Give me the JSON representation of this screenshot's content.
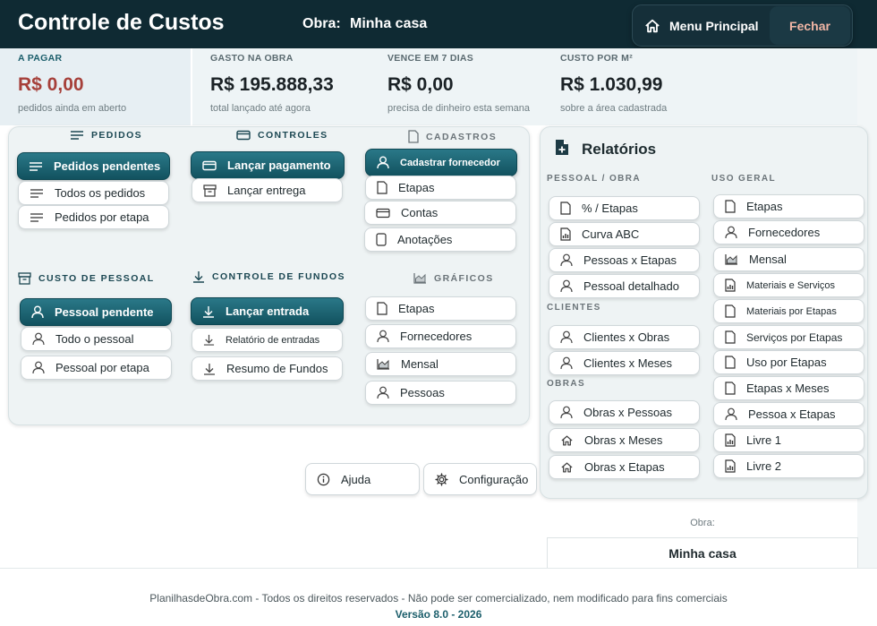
{
  "header": {
    "title": "Controle de Custos",
    "obra_label": "Obra:",
    "obra_name": "Minha casa",
    "menu_label": "Menu Principal",
    "fechar_label": "Fechar"
  },
  "kpis": [
    {
      "label": "A PAGAR",
      "value": "R$ 0,00",
      "sub": "pedidos ainda em aberto"
    },
    {
      "label": "GASTO NA OBRA",
      "value": "R$ 195.888,33",
      "sub": "total lançado até agora"
    },
    {
      "label": "VENCE EM 7 DIAS",
      "value": "R$ 0,00",
      "sub": "precisa de dinheiro esta semana"
    },
    {
      "label": "CUSTO POR M²",
      "value": "R$ 1.030,99",
      "sub": "sobre a área cadastrada"
    }
  ],
  "sections": {
    "pedidos": {
      "title": "PEDIDOS",
      "items": [
        "Pedidos pendentes",
        "Todos os pedidos",
        "Pedidos por etapa"
      ]
    },
    "controles": {
      "title": "CONTROLES",
      "items": [
        "Lançar pagamento",
        "Lançar entrega"
      ]
    },
    "cadastros": {
      "title": "CADASTROS",
      "items": [
        "Cadastrar fornecedor",
        "Etapas",
        "Contas",
        "Anotações"
      ]
    },
    "custo_pessoal": {
      "title": "CUSTO DE PESSOAL",
      "items": [
        "Pessoal pendente",
        "Todo o pessoal",
        "Pessoal por etapa"
      ]
    },
    "controle_fundos": {
      "title": "CONTROLE DE FUNDOS",
      "items": [
        "Lançar entrada",
        "Relatório de entradas",
        "Resumo de Fundos"
      ]
    },
    "graficos": {
      "title": "GRÁFICOS",
      "items": [
        "Etapas",
        "Fornecedores",
        "Mensal",
        "Pessoas"
      ]
    }
  },
  "relatorios": {
    "title": "Relatórios",
    "pessoal_obra": {
      "title": "PESSOAL / OBRA",
      "items": [
        "% / Etapas",
        "Curva ABC",
        "Pessoas x Etapas",
        "Pessoal detalhado"
      ]
    },
    "clientes": {
      "title": "CLIENTES",
      "items": [
        "Clientes x Obras",
        "Clientes x Meses"
      ]
    },
    "obras": {
      "title": "OBRAS",
      "items": [
        "Obras x Pessoas",
        "Obras x Meses",
        "Obras x Etapas"
      ]
    },
    "uso_geral": {
      "title": "USO GERAL",
      "items": [
        "Etapas",
        "Fornecedores",
        "Mensal",
        "Materiais e Serviços",
        "Materiais por Etapas",
        "Serviços por Etapas",
        "Uso por Etapas",
        "Etapas x Meses",
        "Pessoa x Etapas",
        "Livre 1",
        "Livre 2"
      ]
    }
  },
  "bottom": {
    "ajuda": "Ajuda",
    "configuracao": "Configuração"
  },
  "footer": {
    "obra_label": "Obra:",
    "obra_name": "Minha casa",
    "copyright": "PlanilhasdeObra.com - Todos os direitos reservados - Não pode ser comercializado, nem modificado para fins comerciais",
    "version": "Versão 8.0 - 2026"
  },
  "colors": {
    "header_bg": "#0f2a33",
    "primary": "#1d6675",
    "danger_value": "#a6403a",
    "fechar_text": "#f1b6a5"
  }
}
